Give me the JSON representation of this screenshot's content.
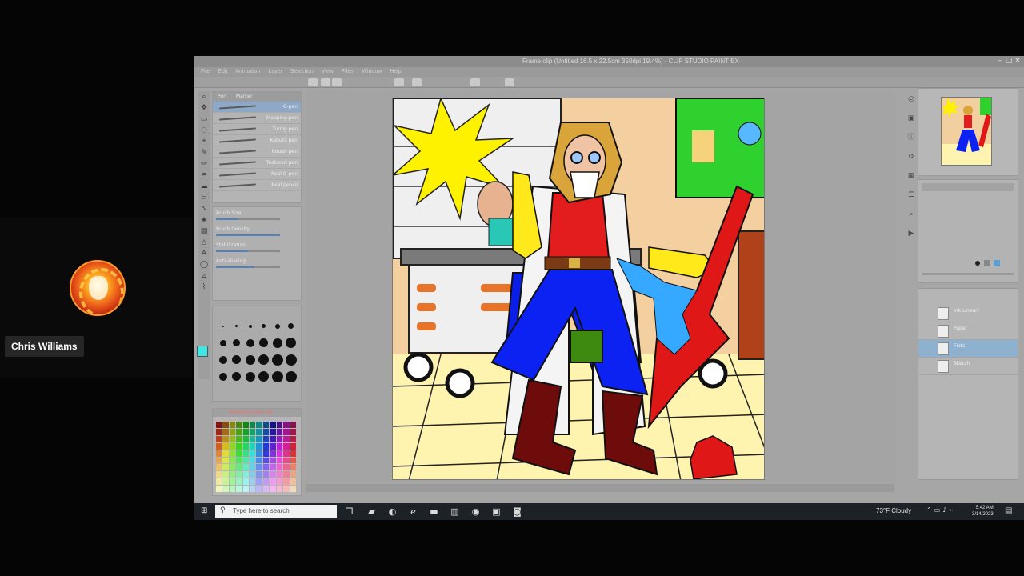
{
  "meeting": {
    "participant_name": "Chris Williams"
  },
  "app": {
    "window_title": "Frame.clip (Untitled 16.5 x 22.5cm 350dpi 19.4%) - CLIP STUDIO PAINT EX",
    "menus": [
      "File",
      "Edit",
      "Animation",
      "Layer",
      "Selection",
      "View",
      "Filter",
      "Window",
      "Help"
    ],
    "subtool_tabs": [
      "Pen",
      "Marker"
    ],
    "brushes": [
      "G-pen",
      "Mapping pen",
      "Turnip pen",
      "Kabura pen",
      "Rough pen",
      "Textured pen",
      "Real G-pen",
      "Real pencil"
    ],
    "tool_properties": [
      {
        "label": "Brush Size",
        "fill": 0.35
      },
      {
        "label": "Brush Density",
        "fill": 1.0
      },
      {
        "label": "Stabilization",
        "fill": 0.5
      },
      {
        "label": "Anti-aliasing",
        "fill": 0.6
      }
    ],
    "colorset_title": "Standard color set",
    "layers": [
      {
        "name": "Ink Lineart",
        "selected": false
      },
      {
        "name": "Paper",
        "selected": false
      },
      {
        "name": "Flats",
        "selected": true
      },
      {
        "name": "Sketch",
        "selected": false
      }
    ]
  },
  "taskbar": {
    "search_placeholder": "Type here to search",
    "weather": "73°F Cloudy",
    "time": "5:42 AM",
    "date": "3/14/2023"
  },
  "colors": {
    "main_color": "#3ee6e6",
    "sub_color": "#000000",
    "accent_selection": "#8db1cf"
  },
  "icons": {
    "start": "windows-start-icon",
    "search": "search-icon",
    "notifications": "notification-icon"
  }
}
